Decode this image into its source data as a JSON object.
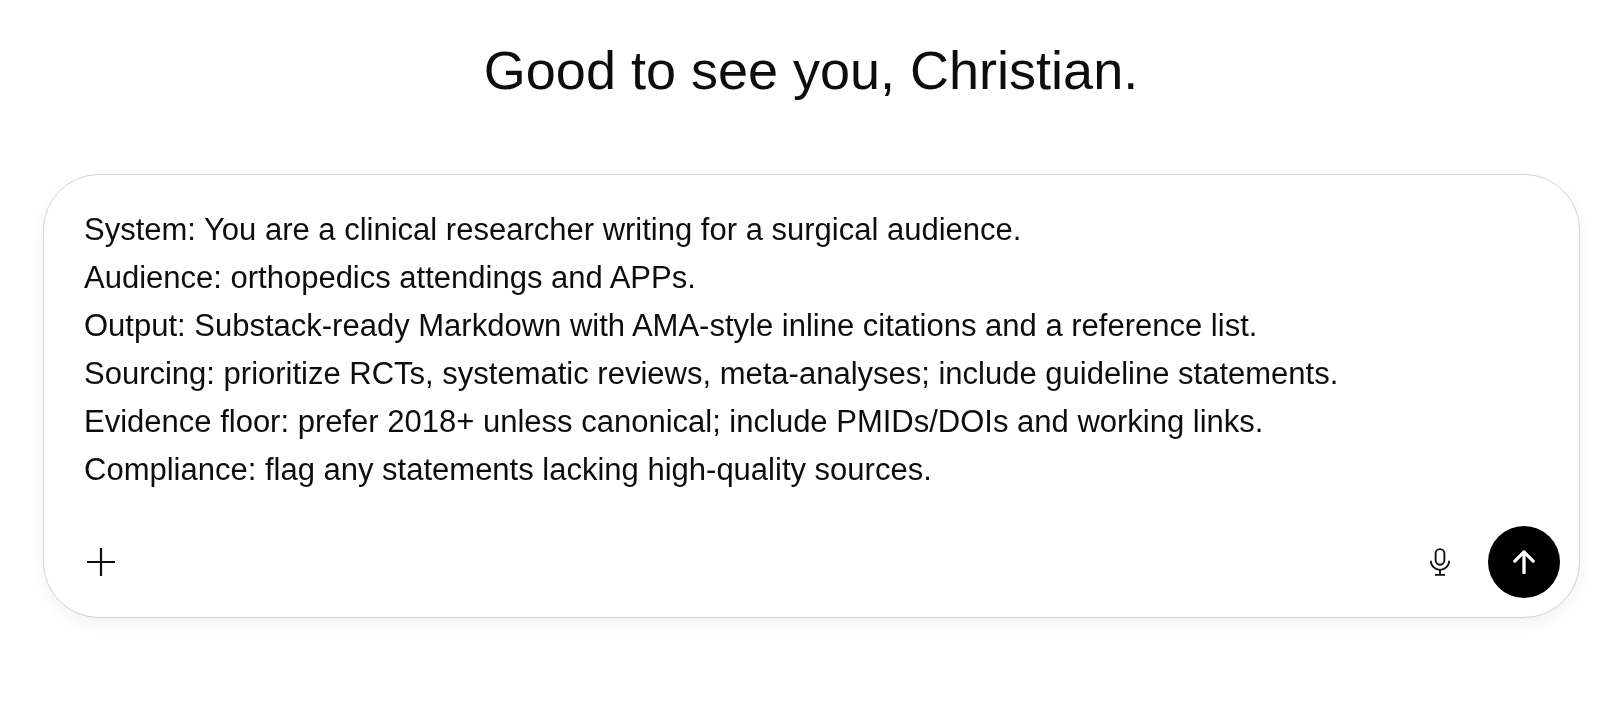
{
  "heading": "Good to see you, Christian.",
  "composer": {
    "value": "System: You are a clinical researcher writing for a surgical audience.\nAudience: orthopedics attendings and APPs.\nOutput: Substack-ready Markdown with AMA-style inline citations and a reference list.\nSourcing: prioritize RCTs, systematic reviews, meta-analyses; include guideline statements.\nEvidence floor: prefer 2018+ unless canonical; include PMIDs/DOIs and working links.\nCompliance: flag any statements lacking high-quality sources."
  }
}
